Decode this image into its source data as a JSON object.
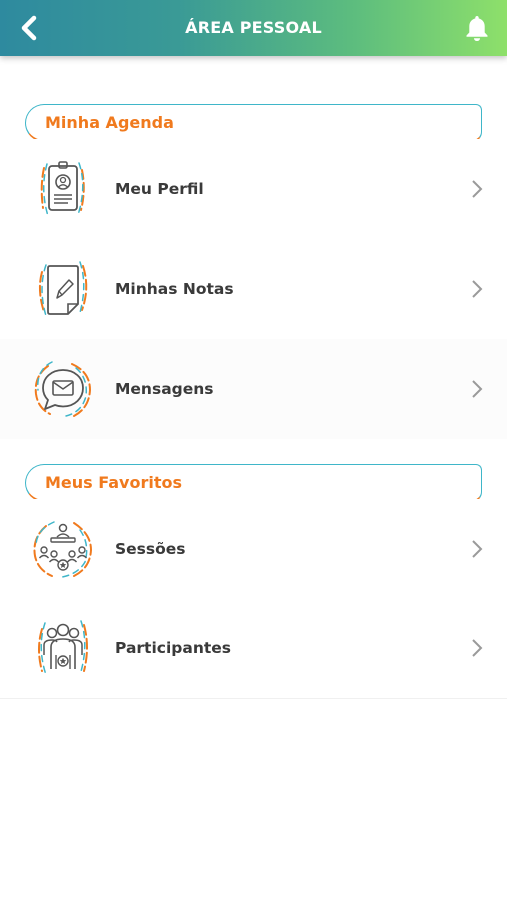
{
  "header": {
    "title": "ÁREA PESSOAL",
    "back_icon": "chevron-left-icon",
    "bell_icon": "bell-icon"
  },
  "sections": [
    {
      "title": "Minha Agenda",
      "items": [
        {
          "label": "Meu Perfil",
          "icon": "profile-card-icon"
        },
        {
          "label": "Minhas Notas",
          "icon": "notes-icon"
        },
        {
          "label": "Mensagens",
          "icon": "messages-icon"
        }
      ]
    },
    {
      "title": "Meus Favoritos",
      "items": [
        {
          "label": "Sessões",
          "icon": "sessions-icon"
        },
        {
          "label": "Participantes",
          "icon": "participants-icon"
        }
      ]
    }
  ],
  "colors": {
    "accent_orange": "#f07a1e",
    "accent_cyan": "#3fb6c9",
    "header_gradient_start": "#2e8a9f",
    "header_gradient_end": "#8ee06a",
    "label_text": "#3a3a3a"
  }
}
